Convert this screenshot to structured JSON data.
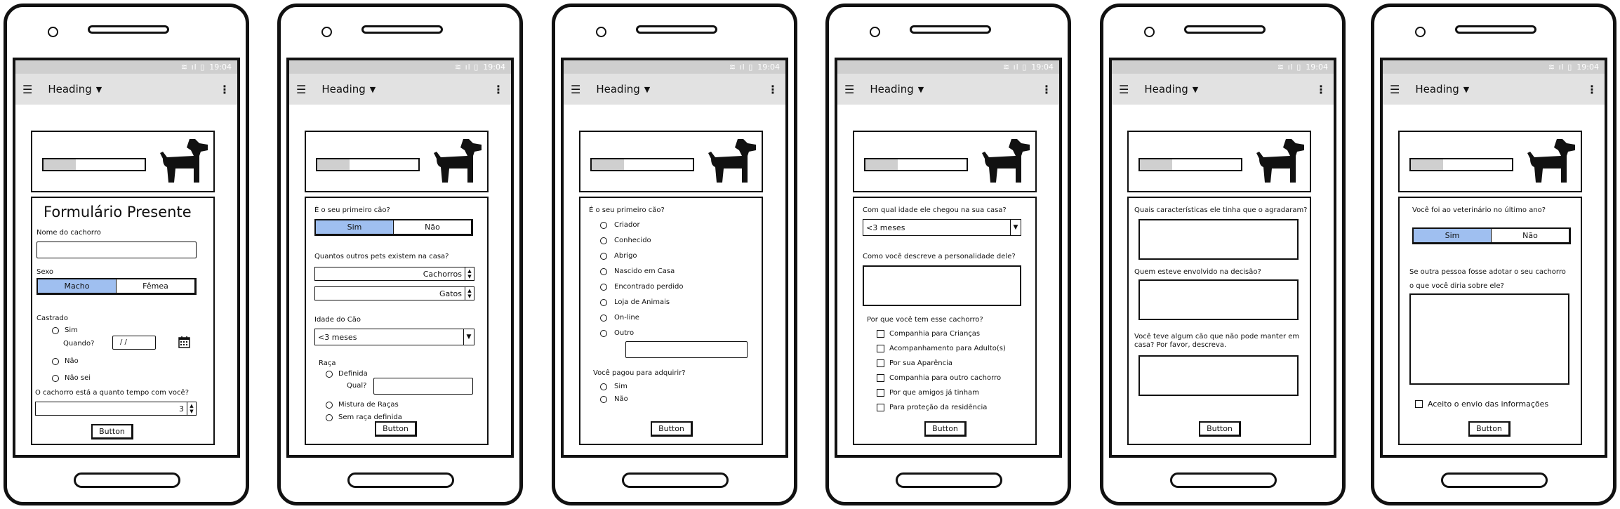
{
  "appbar": {
    "title": "Heading",
    "time": "19:04"
  },
  "screen1": {
    "title": "Formulário Presente",
    "name_label": "Nome do cachorro",
    "sex_label": "Sexo",
    "sex_options": [
      "Macho",
      "Fêmea"
    ],
    "neutered_label": "Castrado",
    "neutered_yes": "Sim",
    "when_label": "Quando?",
    "date_placeholder": "/  /",
    "neutered_no": "Não",
    "neutered_unknown": "Não sei",
    "time_with_you_label": "O cachorro está a quanto tempo com você?",
    "time_with_you_value": "3",
    "button": "Button"
  },
  "screen2": {
    "first_dog_label": "É o seu primeiro cão?",
    "first_dog_options": [
      "Sim",
      "Não"
    ],
    "other_pets_label": "Quantos outros pets existem na casa?",
    "dogs_value": "Cachorros",
    "cats_value": "Gatos",
    "age_label": "Idade do Cão",
    "age_value": "<3 meses",
    "breed_label": "Raça",
    "breed_defined": "Definida",
    "breed_which": "Qual?",
    "breed_mixed": "Mistura de Raças",
    "breed_none": "Sem raça definida",
    "button": "Button"
  },
  "screen3": {
    "first_dog_label": "É o seu primeiro cão?",
    "options": [
      "Criador",
      "Conhecido",
      "Abrigo",
      "Nascido em Casa",
      "Encontrado perdido",
      "Loja de Animais",
      "On-line",
      "Outro"
    ],
    "paid_label": "Você pagou para adquirir?",
    "paid_options": [
      "Sim",
      "Não"
    ],
    "button": "Button"
  },
  "screen4": {
    "age_arrived_label": "Com qual idade ele chegou na sua casa?",
    "age_arrived_value": "<3 meses",
    "personality_label": "Como você descreve a personalidade dele?",
    "why_label": "Por que você tem esse cachorro?",
    "reasons": [
      "Companhia para Crianças",
      "Acompanhamento para Adulto(s)",
      "Por sua Aparência",
      "Companhia para outro cachorro",
      "Por que amigos já tinham",
      "Para proteção da residência"
    ],
    "button": "Button"
  },
  "screen5": {
    "traits_label": "Quais características ele tinha que o agradaram?",
    "decision_label": "Quem esteve envolvido na decisão?",
    "previous_dog_label": "Você teve algum cão que não pode manter em casa? Por favor, descreva.",
    "button": "Button"
  },
  "screen6": {
    "vet_label": "Você foi ao veterinário no último ano?",
    "vet_options": [
      "Sim",
      "Não"
    ],
    "adopt_label_1": "Se outra pessoa fosse adotar o seu cachorro",
    "adopt_label_2": "o que você diria sobre ele?",
    "consent_label": "Aceito o envio das informações",
    "button": "Button"
  }
}
